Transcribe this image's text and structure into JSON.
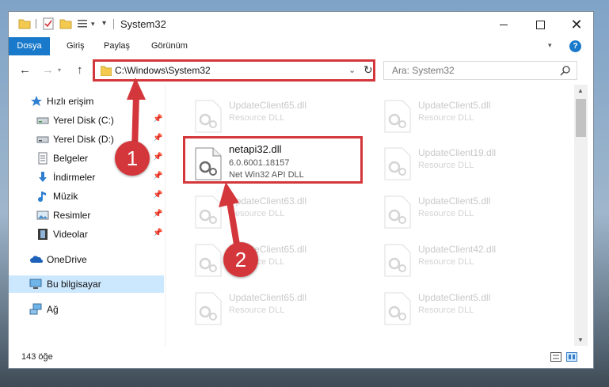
{
  "window": {
    "title": "System32"
  },
  "ribbon": {
    "tabs": [
      {
        "label": "Dosya"
      },
      {
        "label": "Giriş"
      },
      {
        "label": "Paylaş"
      },
      {
        "label": "Görünüm"
      }
    ],
    "help_label": "?"
  },
  "address": {
    "path": "C:\\Windows\\System32"
  },
  "search": {
    "placeholder": "Ara: System32"
  },
  "sidebar": {
    "items": [
      {
        "label": "Hızlı erişim",
        "icon": "star-icon",
        "pinned": false
      },
      {
        "label": "Yerel Disk (C:)",
        "icon": "drive-icon",
        "pinned": true
      },
      {
        "label": "Yerel Disk (D:)",
        "icon": "drive-icon",
        "pinned": true
      },
      {
        "label": "Belgeler",
        "icon": "documents-icon",
        "pinned": true
      },
      {
        "label": "İndirmeler",
        "icon": "download-icon",
        "pinned": true
      },
      {
        "label": "Müzik",
        "icon": "music-icon",
        "pinned": true
      },
      {
        "label": "Resimler",
        "icon": "pictures-icon",
        "pinned": true
      },
      {
        "label": "Videolar",
        "icon": "videos-icon",
        "pinned": true
      },
      {
        "label": "OneDrive",
        "icon": "cloud-icon",
        "pinned": false
      },
      {
        "label": "Bu bilgisayar",
        "icon": "computer-icon",
        "pinned": false,
        "selected": true
      },
      {
        "label": "Ağ",
        "icon": "network-icon",
        "pinned": false
      }
    ]
  },
  "files": [
    {
      "name": "UpdateClient65.dll",
      "desc": "Resource DLL"
    },
    {
      "name": "UpdateClient5.dll",
      "desc": "Resource DLL"
    },
    {
      "name": "netapi32.dll",
      "version": "6.0.6001.18157",
      "desc": "Net Win32 API DLL"
    },
    {
      "name": "UpdateClient19.dll",
      "desc": "Resource DLL"
    },
    {
      "name": "UpdateClient63.dll",
      "desc": "Resource DLL"
    },
    {
      "name": "UpdateClient5.dll",
      "desc": "Resource DLL"
    },
    {
      "name": "UpdateClient65.dll",
      "desc": "Resource DLL"
    },
    {
      "name": "UpdateClient42.dll",
      "desc": "Resource DLL"
    },
    {
      "name": "UpdateClient65.dll",
      "desc": "Resource DLL"
    },
    {
      "name": "UpdateClient5.dll",
      "desc": "Resource DLL"
    }
  ],
  "status": {
    "item_count": "143 öğe"
  },
  "annotations": {
    "step1": "1",
    "step2": "2",
    "color": "#d4373b"
  },
  "colors": {
    "accent": "#1979ca",
    "selection": "#cce8ff"
  }
}
